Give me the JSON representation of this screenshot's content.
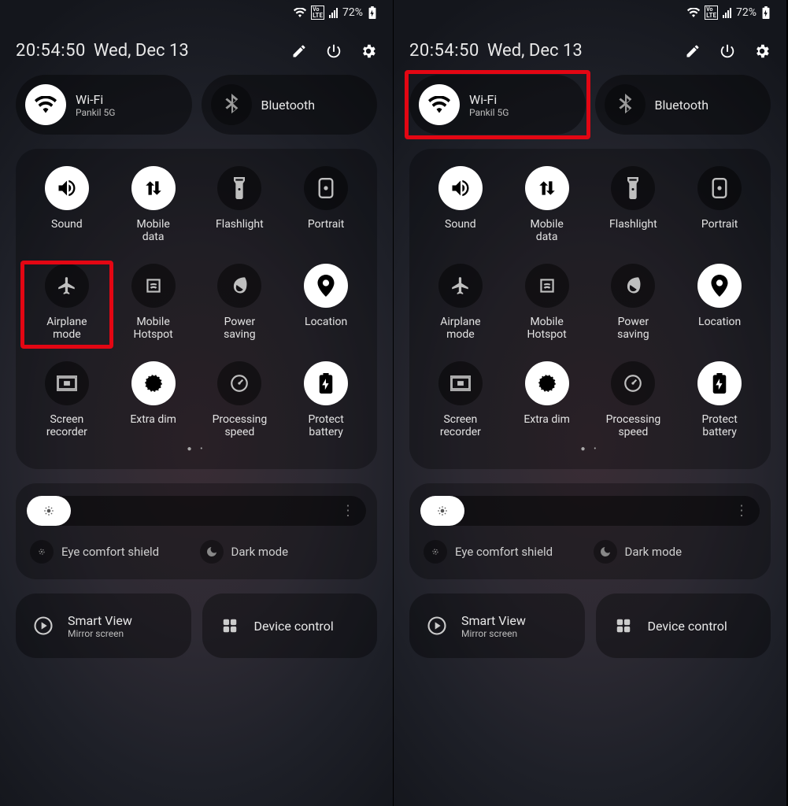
{
  "status": {
    "volte": "VoLTE",
    "battery_pct": "72%"
  },
  "header": {
    "time": "20:54:50",
    "date": "Wed, Dec 13"
  },
  "pills": {
    "wifi": {
      "title": "Wi-Fi",
      "subtitle": "Pankil 5G"
    },
    "bluetooth": {
      "title": "Bluetooth"
    }
  },
  "tiles": [
    {
      "id": "sound",
      "label": "Sound",
      "on": true
    },
    {
      "id": "mobile-data",
      "label": "Mobile\ndata",
      "on": true
    },
    {
      "id": "flashlight",
      "label": "Flashlight",
      "on": false
    },
    {
      "id": "portrait",
      "label": "Portrait",
      "on": false
    },
    {
      "id": "airplane",
      "label": "Airplane\nmode",
      "on": false
    },
    {
      "id": "hotspot",
      "label": "Mobile\nHotspot",
      "on": false
    },
    {
      "id": "power-saving",
      "label": "Power\nsaving",
      "on": false
    },
    {
      "id": "location",
      "label": "Location",
      "on": true
    },
    {
      "id": "screen-rec",
      "label": "Screen\nrecorder",
      "on": false
    },
    {
      "id": "extra-dim",
      "label": "Extra dim",
      "on": true
    },
    {
      "id": "proc-speed",
      "label": "Processing\nspeed",
      "on": false
    },
    {
      "id": "protect-bat",
      "label": "Protect\nbattery",
      "on": true
    }
  ],
  "brightness": {
    "percent": 13
  },
  "toggles": {
    "eye": "Eye comfort shield",
    "dark": "Dark mode"
  },
  "bottom": {
    "smartview": {
      "title": "Smart View",
      "subtitle": "Mirror screen"
    },
    "devicectrl": {
      "title": "Device control"
    }
  },
  "highlights": {
    "left": "airplane",
    "right": "wifi"
  }
}
